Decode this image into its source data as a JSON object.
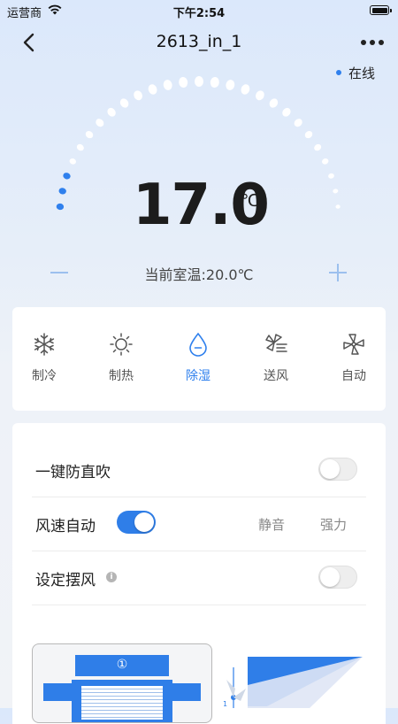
{
  "status_bar": {
    "carrier": "运营商",
    "time": "下午2:54"
  },
  "nav": {
    "title": "2613_in_1"
  },
  "status": {
    "online_label": "在线",
    "online_color": "#2f80ed"
  },
  "thermostat": {
    "set_temp": "17.0",
    "unit": "℃",
    "room_temp_text": "当前室温:20.0℃",
    "minus_label": "−",
    "plus_label": "+"
  },
  "modes": [
    {
      "label": "制冷",
      "icon": "snowflake-icon",
      "active": false
    },
    {
      "label": "制热",
      "icon": "sun-icon",
      "active": false
    },
    {
      "label": "除湿",
      "icon": "water-drop-icon",
      "active": true
    },
    {
      "label": "送风",
      "icon": "fan-wind-icon",
      "active": false
    },
    {
      "label": "自动",
      "icon": "fan-auto-icon",
      "active": false
    }
  ],
  "settings": {
    "anti_direct_blow": {
      "label": "一键防直吹",
      "enabled": false
    },
    "fan_speed": {
      "label": "风速自动",
      "auto_enabled": true,
      "options": [
        "静音",
        "强力"
      ]
    },
    "swing": {
      "label": "设定摆风",
      "enabled": false
    }
  },
  "diagram": {
    "marker": "①",
    "marker_small": "1"
  },
  "colors": {
    "accent": "#2f80ed",
    "dot_inactive": "#ffffff"
  }
}
